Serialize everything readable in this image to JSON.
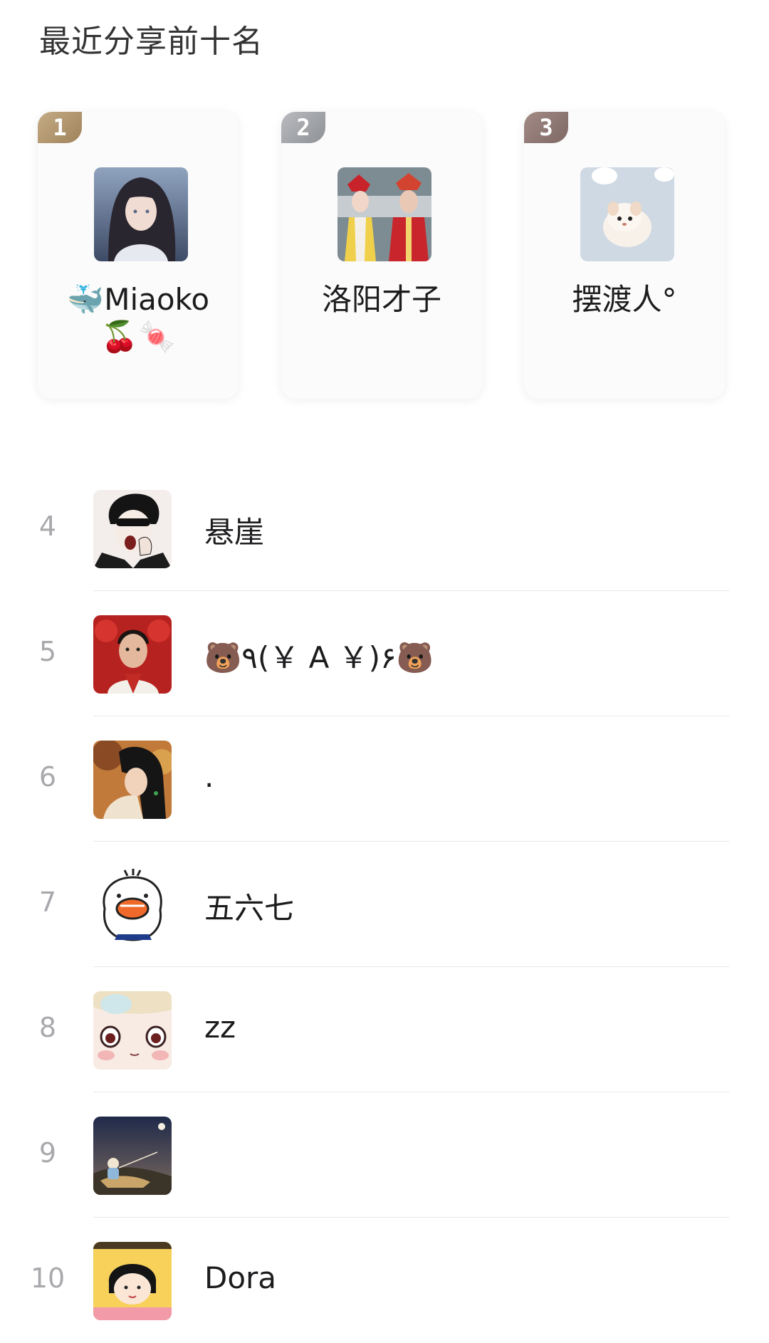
{
  "header": {
    "title": "最近分享前十名"
  },
  "podium": [
    {
      "rank": "1",
      "name_line1": "🐳Miaoko",
      "name_line2": "🍒🍬"
    },
    {
      "rank": "2",
      "name_line1": "洛阳才子",
      "name_line2": ""
    },
    {
      "rank": "3",
      "name_line1": "摆渡人°",
      "name_line2": ""
    }
  ],
  "list": [
    {
      "rank": "4",
      "name": "悬崖"
    },
    {
      "rank": "5",
      "name": "🐻٩(￥ A ￥)۶🐻"
    },
    {
      "rank": "6",
      "name": "."
    },
    {
      "rank": "7",
      "name": "五六七"
    },
    {
      "rank": "8",
      "name": "zz"
    },
    {
      "rank": "9",
      "name": ""
    },
    {
      "rank": "10",
      "name": "Dora"
    }
  ]
}
